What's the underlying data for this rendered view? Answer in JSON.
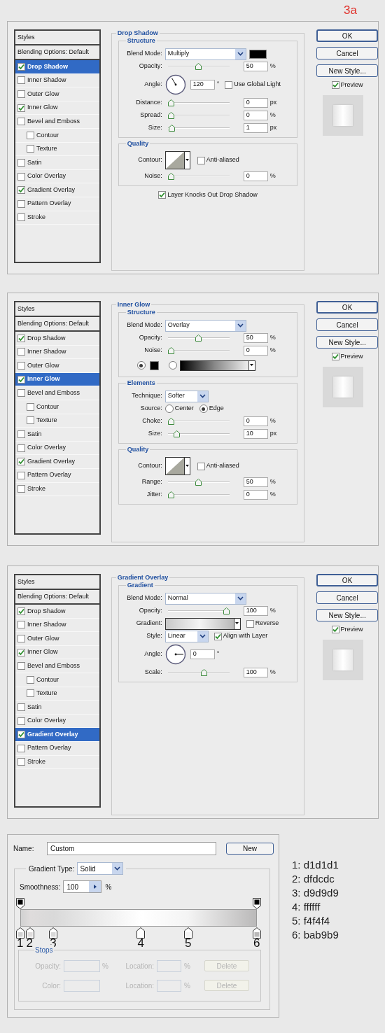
{
  "step_label": "3a",
  "dialogs": [
    {
      "styles_header": "Styles",
      "styles": [
        {
          "label": "Blending Options: Default",
          "kind": "options",
          "selected": false
        },
        {
          "label": "Drop Shadow",
          "kind": "effect",
          "checked": true,
          "selected": true
        },
        {
          "label": "Inner Shadow",
          "kind": "effect",
          "checked": false,
          "selected": false
        },
        {
          "label": "Outer Glow",
          "kind": "effect",
          "checked": false,
          "selected": false
        },
        {
          "label": "Inner Glow",
          "kind": "effect",
          "checked": true,
          "selected": false
        },
        {
          "label": "Bevel and Emboss",
          "kind": "effect",
          "checked": false,
          "selected": false,
          "children": [
            {
              "label": "Contour",
              "kind": "effect",
              "checked": false,
              "selected": false
            },
            {
              "label": "Texture",
              "kind": "effect",
              "checked": false,
              "selected": false
            }
          ]
        },
        {
          "label": "Satin",
          "kind": "effect",
          "checked": false,
          "selected": false
        },
        {
          "label": "Color Overlay",
          "kind": "effect",
          "checked": false,
          "selected": false
        },
        {
          "label": "Gradient Overlay",
          "kind": "effect",
          "checked": true,
          "selected": false
        },
        {
          "label": "Pattern Overlay",
          "kind": "effect",
          "checked": false,
          "selected": false
        },
        {
          "label": "Stroke",
          "kind": "effect",
          "checked": false,
          "selected": false
        }
      ],
      "panel": {
        "title": "Drop Shadow",
        "groups": [
          {
            "title": "Structure",
            "rows": [
              {
                "kind": "select",
                "label": "Blend Mode:",
                "value": "Multiply",
                "has_swatch": true
              },
              {
                "kind": "slider",
                "label": "Opacity:",
                "level": 0.5,
                "value": "50",
                "unit": "%"
              },
              {
                "kind": "angle",
                "label": "Angle:",
                "value": "120",
                "unit": "°",
                "checkbox": {
                  "label": "Use Global Light",
                  "checked": false
                }
              },
              {
                "kind": "slider",
                "label": "Distance:",
                "level": 0,
                "value": "0",
                "unit": "px"
              },
              {
                "kind": "slider",
                "label": "Spread:",
                "level": 0,
                "value": "0",
                "unit": "%"
              },
              {
                "kind": "slider",
                "label": "Size:",
                "level": 0.01,
                "value": "1",
                "unit": "px"
              }
            ]
          },
          {
            "title": "Quality",
            "rows": [
              {
                "kind": "contour",
                "label": "Contour:",
                "checkbox": {
                  "label": "Anti-aliased",
                  "checked": false
                }
              },
              {
                "kind": "slider",
                "label": "Noise:",
                "level": 0,
                "value": "0",
                "unit": "%"
              }
            ]
          }
        ],
        "footer_checkbox": {
          "label": "Layer Knocks Out Drop Shadow",
          "checked": true
        }
      },
      "buttons": [
        "OK",
        "Cancel",
        "New Style..."
      ],
      "preview": {
        "label": "Preview",
        "checked": true
      }
    },
    {
      "styles_header": "Styles",
      "styles": [
        {
          "label": "Blending Options: Default",
          "kind": "options",
          "selected": false
        },
        {
          "label": "Drop Shadow",
          "kind": "effect",
          "checked": true,
          "selected": false
        },
        {
          "label": "Inner Shadow",
          "kind": "effect",
          "checked": false,
          "selected": false
        },
        {
          "label": "Outer Glow",
          "kind": "effect",
          "checked": false,
          "selected": false
        },
        {
          "label": "Inner Glow",
          "kind": "effect",
          "checked": true,
          "selected": true
        },
        {
          "label": "Bevel and Emboss",
          "kind": "effect",
          "checked": false,
          "selected": false,
          "children": [
            {
              "label": "Contour",
              "kind": "effect",
              "checked": false,
              "selected": false
            },
            {
              "label": "Texture",
              "kind": "effect",
              "checked": false,
              "selected": false
            }
          ]
        },
        {
          "label": "Satin",
          "kind": "effect",
          "checked": false,
          "selected": false
        },
        {
          "label": "Color Overlay",
          "kind": "effect",
          "checked": false,
          "selected": false
        },
        {
          "label": "Gradient Overlay",
          "kind": "effect",
          "checked": true,
          "selected": false
        },
        {
          "label": "Pattern Overlay",
          "kind": "effect",
          "checked": false,
          "selected": false
        },
        {
          "label": "Stroke",
          "kind": "effect",
          "checked": false,
          "selected": false
        }
      ],
      "panel": {
        "title": "Inner Glow",
        "groups": [
          {
            "title": "Structure",
            "rows": [
              {
                "kind": "select",
                "label": "Blend Mode:",
                "value": "Overlay"
              },
              {
                "kind": "slider",
                "label": "Opacity:",
                "level": 0.5,
                "value": "50",
                "unit": "%"
              },
              {
                "kind": "slider",
                "label": "Noise:",
                "level": 0,
                "value": "0",
                "unit": "%"
              },
              {
                "kind": "glow-color",
                "solid": {
                  "selected": true
                },
                "gradient": {
                  "selected": false
                }
              }
            ]
          },
          {
            "title": "Elements",
            "rows": [
              {
                "kind": "short-select",
                "label": "Technique:",
                "value": "Softer"
              },
              {
                "kind": "radios",
                "label": "Source:",
                "options": [
                  {
                    "label": "Center",
                    "selected": false
                  },
                  {
                    "label": "Edge",
                    "selected": true
                  }
                ]
              },
              {
                "kind": "slider",
                "label": "Choke:",
                "level": 0,
                "value": "0",
                "unit": "%"
              },
              {
                "kind": "slider",
                "label": "Size:",
                "level": 0.1,
                "value": "10",
                "unit": "px"
              }
            ]
          },
          {
            "title": "Quality",
            "rows": [
              {
                "kind": "contour",
                "label": "Contour:",
                "checkbox": {
                  "label": "Anti-aliased",
                  "checked": false
                }
              },
              {
                "kind": "slider",
                "label": "Range:",
                "level": 0.5,
                "value": "50",
                "unit": "%"
              },
              {
                "kind": "slider",
                "label": "Jitter:",
                "level": 0,
                "value": "0",
                "unit": "%"
              }
            ]
          }
        ]
      },
      "buttons": [
        "OK",
        "Cancel",
        "New Style..."
      ],
      "preview": {
        "label": "Preview",
        "checked": true
      }
    },
    {
      "styles_header": "Styles",
      "styles": [
        {
          "label": "Blending Options: Default",
          "kind": "options",
          "selected": false
        },
        {
          "label": "Drop Shadow",
          "kind": "effect",
          "checked": true,
          "selected": false
        },
        {
          "label": "Inner Shadow",
          "kind": "effect",
          "checked": false,
          "selected": false
        },
        {
          "label": "Outer Glow",
          "kind": "effect",
          "checked": false,
          "selected": false
        },
        {
          "label": "Inner Glow",
          "kind": "effect",
          "checked": true,
          "selected": false
        },
        {
          "label": "Bevel and Emboss",
          "kind": "effect",
          "checked": false,
          "selected": false,
          "children": [
            {
              "label": "Contour",
              "kind": "effect",
              "checked": false,
              "selected": false
            },
            {
              "label": "Texture",
              "kind": "effect",
              "checked": false,
              "selected": false
            }
          ]
        },
        {
          "label": "Satin",
          "kind": "effect",
          "checked": false,
          "selected": false
        },
        {
          "label": "Color Overlay",
          "kind": "effect",
          "checked": false,
          "selected": false
        },
        {
          "label": "Gradient Overlay",
          "kind": "effect",
          "checked": true,
          "selected": true
        },
        {
          "label": "Pattern Overlay",
          "kind": "effect",
          "checked": false,
          "selected": false
        },
        {
          "label": "Stroke",
          "kind": "effect",
          "checked": false,
          "selected": false
        }
      ],
      "panel": {
        "title": "Gradient Overlay",
        "groups": [
          {
            "title": "Gradient",
            "rows": [
              {
                "kind": "select",
                "label": "Blend Mode:",
                "value": "Normal"
              },
              {
                "kind": "slider",
                "label": "Opacity:",
                "level": 1,
                "value": "100",
                "unit": "%"
              },
              {
                "kind": "gradient",
                "label": "Gradient:",
                "checkbox": {
                  "label": "Reverse",
                  "checked": false
                }
              },
              {
                "kind": "short-select",
                "label": "Style:",
                "value": "Linear",
                "checkbox": {
                  "label": "Align with Layer",
                  "checked": true
                }
              },
              {
                "kind": "angle",
                "label": "Angle:",
                "value": "0",
                "unit": "°"
              },
              {
                "kind": "slider",
                "label": "Scale:",
                "level": 0.6,
                "value": "100",
                "unit": "%"
              }
            ]
          }
        ]
      },
      "buttons": [
        "OK",
        "Cancel",
        "New Style..."
      ],
      "preview": {
        "label": "Preview",
        "checked": true
      }
    }
  ],
  "gradient_editor": {
    "name_label": "Name:",
    "name_value": "Custom",
    "new_button": "New",
    "type_label": "Gradient Type:",
    "type_value": "Solid",
    "smoothness_label": "Smoothness:",
    "smoothness_value": "100",
    "smoothness_unit": "%",
    "opacity_stops": [
      {
        "level": 0
      },
      {
        "level": 1
      }
    ],
    "color_stops": [
      {
        "number": "1",
        "level": 0,
        "color": "#d1d1d1"
      },
      {
        "number": "2",
        "level": 0.04,
        "color": "#dfdcdc"
      },
      {
        "number": "3",
        "level": 0.14,
        "color": "#d9d9d9"
      },
      {
        "number": "4",
        "level": 0.51,
        "color": "#ffffff"
      },
      {
        "number": "5",
        "level": 0.71,
        "color": "#f4f4f4"
      },
      {
        "number": "6",
        "level": 1,
        "color": "#bab9b9"
      }
    ],
    "stops_title": "Stops",
    "stop_rows": [
      {
        "label": "Opacity:",
        "unit": "%",
        "location_label": "Location:",
        "location_unit": "%",
        "button": "Delete",
        "disabled": true
      },
      {
        "label": "Color:",
        "location_label": "Location:",
        "location_unit": "%",
        "button": "Delete",
        "disabled": true
      }
    ]
  },
  "color_notes": [
    "1: d1d1d1",
    "2: dfdcdc",
    "3: d9d9d9",
    "4: ffffff",
    "5: f4f4f4",
    "6: bab9b9"
  ]
}
